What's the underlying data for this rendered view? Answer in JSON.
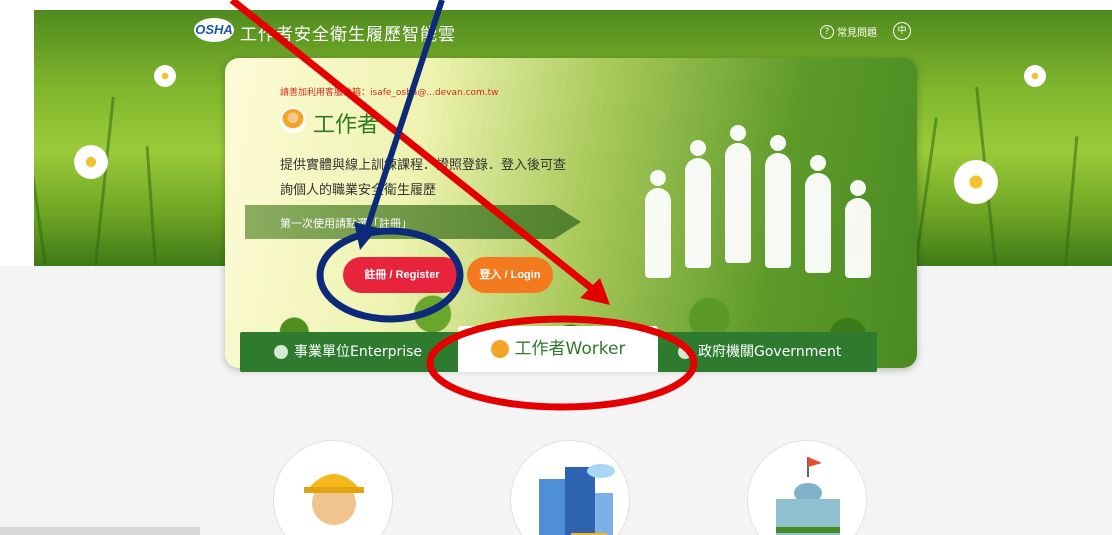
{
  "header": {
    "logo_text": "OSHA",
    "site_title": "工作者安全衛生履歷智能雲",
    "faq_label": "常見問題",
    "lang_label": "中"
  },
  "card": {
    "notice": "請善加利用客服信箱：isafe_osha@...devan.com.tw",
    "role_title": "工作者",
    "description": "提供實體與線上訓練課程．證照登錄．登入後可查詢個人的職業安全衛生履歷",
    "first_use": "第一次使用請點選「註冊」",
    "register_button": "註冊 / Register",
    "login_button": "登入 / Login"
  },
  "tabs": [
    {
      "label": "事業單位Enterprise"
    },
    {
      "label": "工作者Worker"
    },
    {
      "label": "政府機關Government"
    }
  ],
  "annotation_colors": {
    "red": "#e50000",
    "navy": "#0d2a7a"
  }
}
